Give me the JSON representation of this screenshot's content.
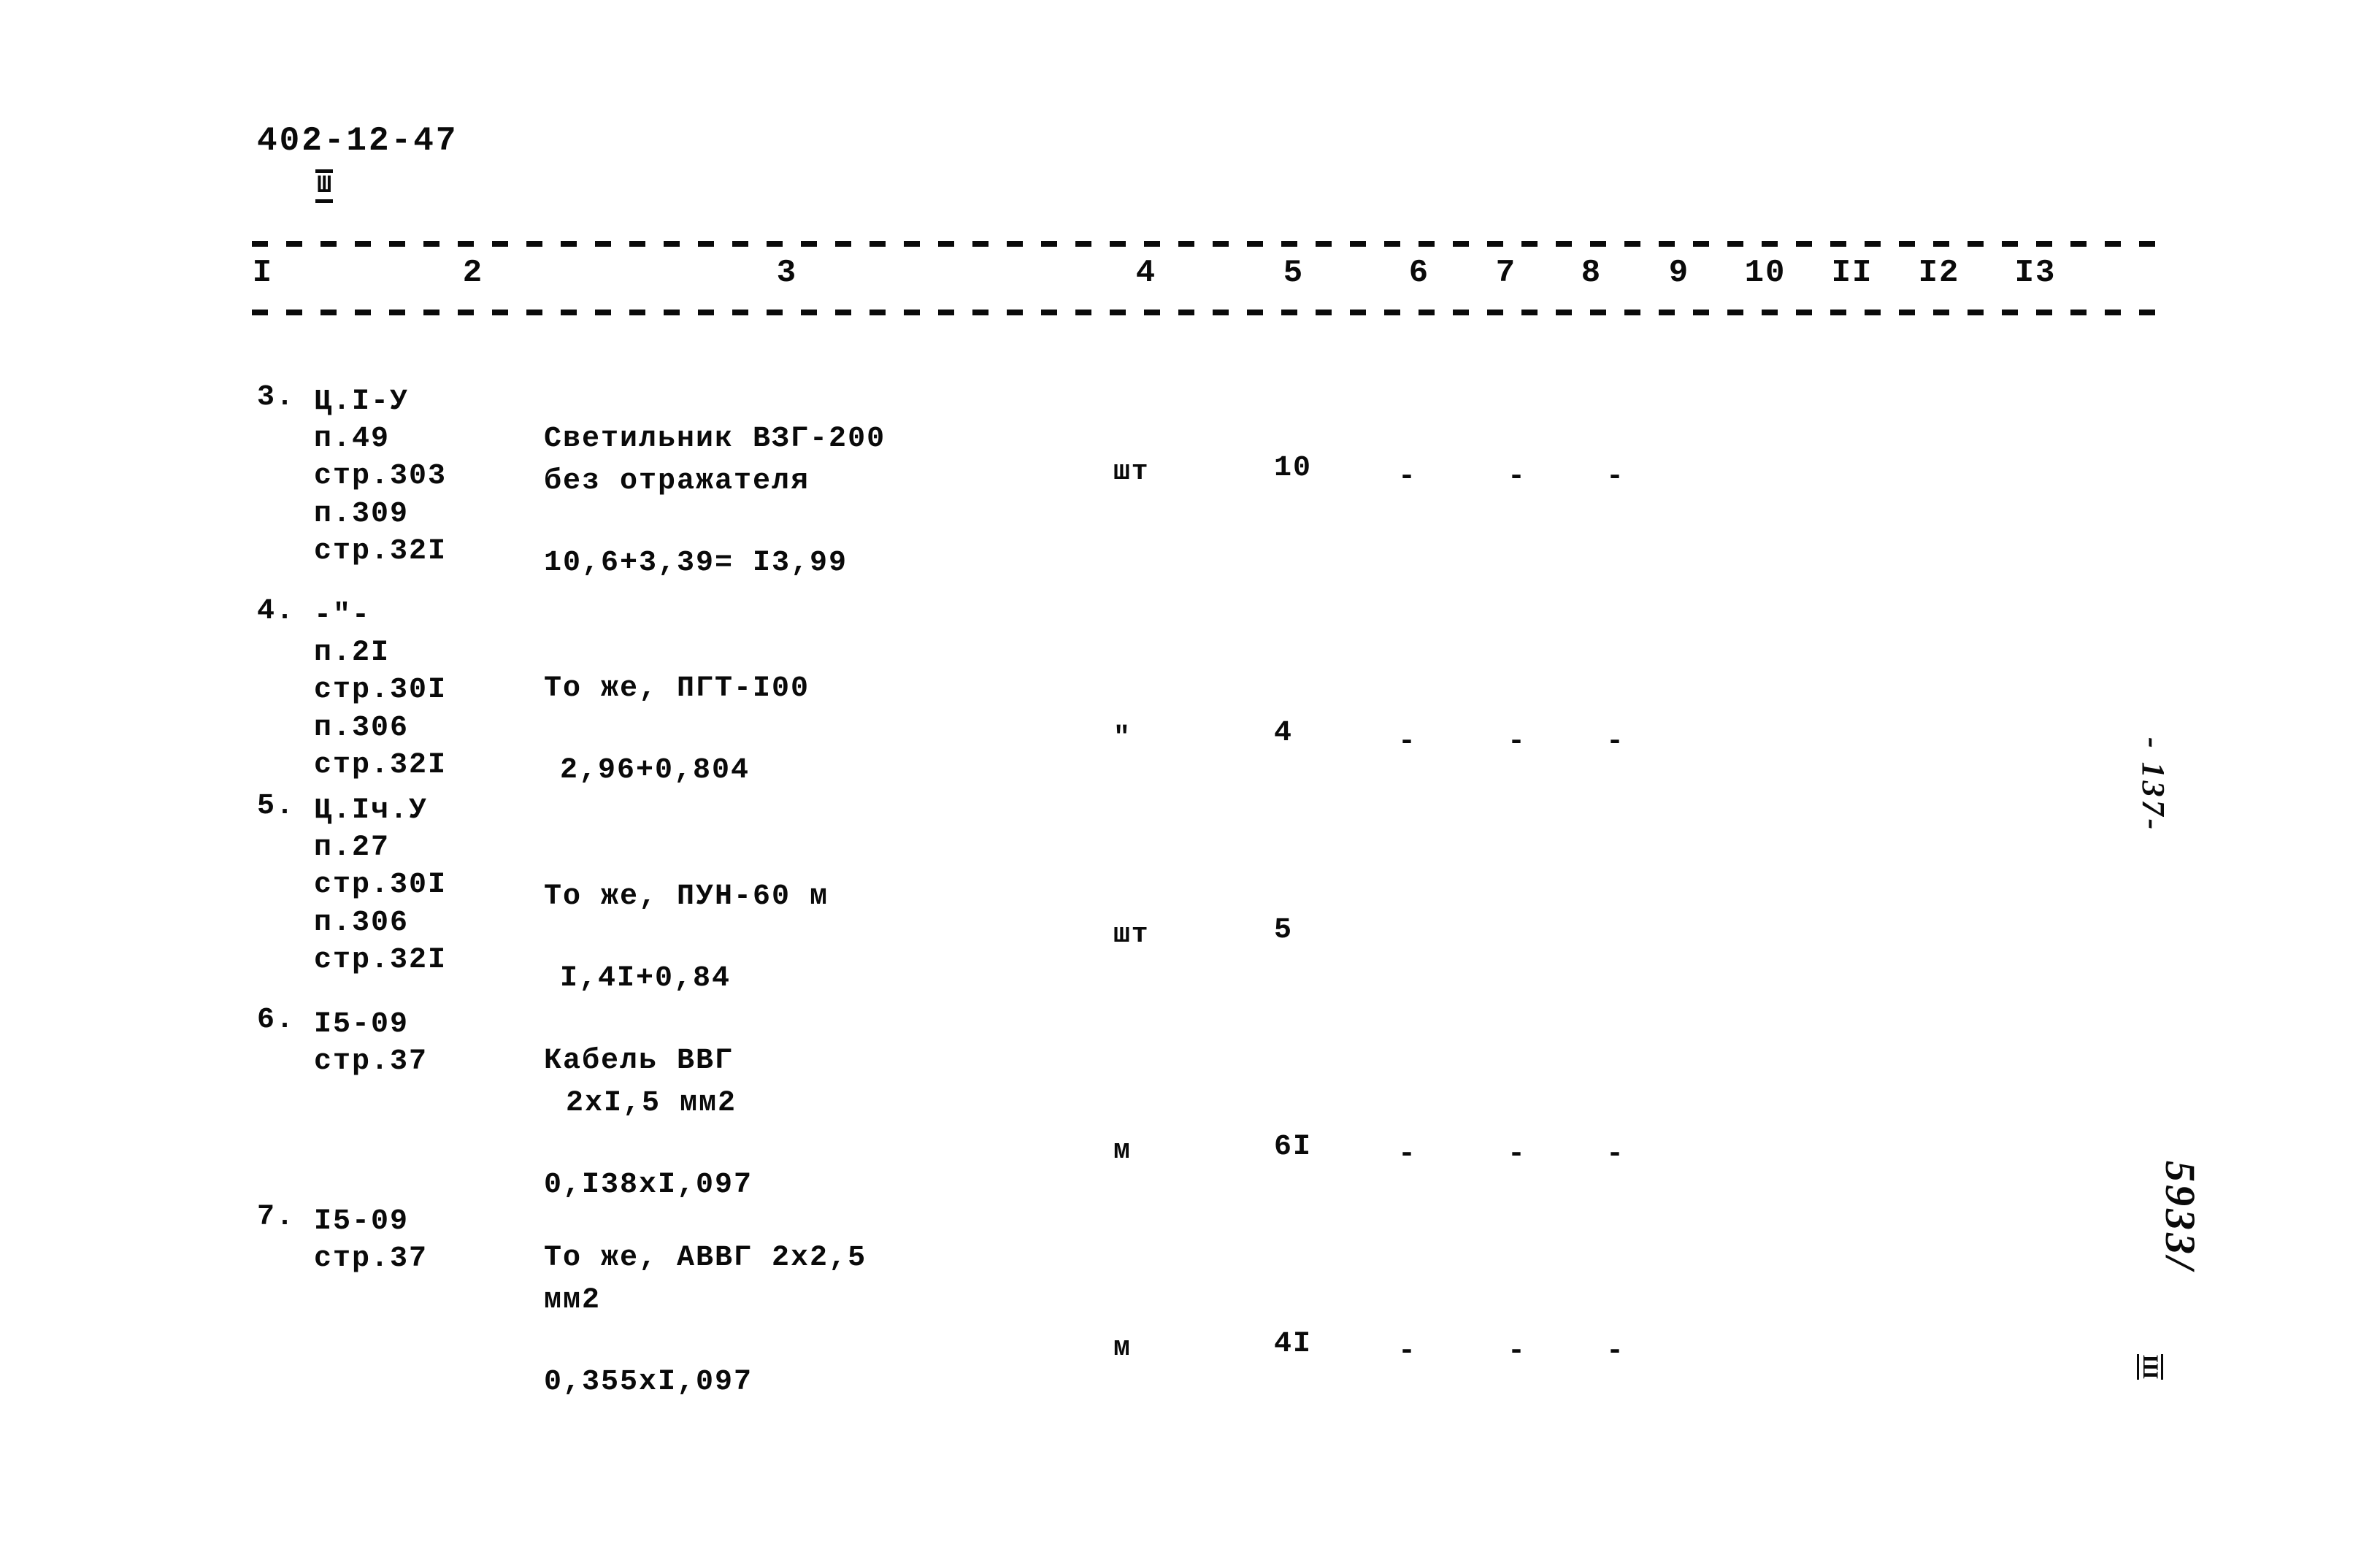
{
  "document": {
    "code": "402-12-47",
    "volume_mark": "Ш"
  },
  "table": {
    "column_headers": [
      "I",
      "2",
      "3",
      "4",
      "5",
      "6",
      "7",
      "8",
      "9",
      "10",
      "II",
      "I2",
      "I3"
    ],
    "dash_mark": "-",
    "rows": [
      {
        "number": "3.",
        "reference_lines": [
          "Ц.I-У",
          "п.49",
          "стр.303",
          "п.309",
          "стр.32I"
        ],
        "description_lines": [
          "Светильник ВЗГ-200",
          "без отражателя",
          "10,6+3,39= I3,99"
        ],
        "unit": "шт",
        "quantity": "10",
        "dashes": [
          "-",
          "-",
          "-"
        ]
      },
      {
        "number": "4.",
        "reference_lines": [
          "-\"-",
          "п.2I",
          "стр.30I",
          "п.306",
          "стр.32I"
        ],
        "description_lines": [
          "То же, ПГТ-I00",
          "2,96+0,804"
        ],
        "unit": "\"",
        "quantity": "4",
        "dashes": [
          "-",
          "-",
          "-"
        ]
      },
      {
        "number": "5.",
        "reference_lines": [
          "Ц.Iч.У",
          "п.27",
          "стр.30I",
          "п.306",
          "стр.32I"
        ],
        "description_lines": [
          "То же, ПУН-60 м",
          "I,4I+0,84"
        ],
        "unit": "шт",
        "quantity": "5",
        "dashes": []
      },
      {
        "number": "6.",
        "reference_lines": [
          "I5-09",
          "стр.37"
        ],
        "description_lines": [
          "Кабель ВВГ",
          "2хI,5 мм2",
          "0,I38хI,097"
        ],
        "unit": "м",
        "quantity": "6I",
        "dashes": [
          "-",
          "-",
          "-"
        ]
      },
      {
        "number": "7.",
        "reference_lines": [
          "I5-09",
          "стр.37"
        ],
        "description_lines": [
          "То же, АВВГ 2х2,5",
          "мм2",
          "0,355хI,097"
        ],
        "unit": "м",
        "quantity": "4I",
        "dashes": [
          "-",
          "-",
          "-"
        ]
      }
    ]
  },
  "margin_notes": {
    "page_folio": "- 137-",
    "archive_number": "5933/",
    "archive_sub": "Ш"
  }
}
